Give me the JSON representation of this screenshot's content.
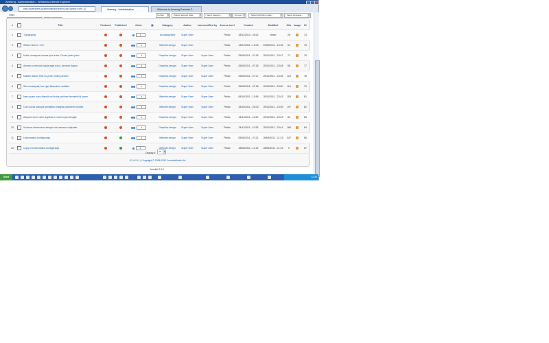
{
  "window": {
    "title": "Avarnng - Administration - Windows Internet Explorer",
    "url": "http://avarolliers.pl/administrator/index.php?option=com_k2",
    "tabs": [
      {
        "label": "Avarnng - Administration",
        "active": true
      },
      {
        "label": "Welcome to Avarnng Przeslan Z...",
        "active": false
      }
    ]
  },
  "filter": {
    "label": "Filter:",
    "go_label": "Go",
    "reset_label": "Reset",
    "selects": [
      "Current",
      "- Select featured state -",
      "- Select category -",
      "- No user -",
      "- Select publishing state -",
      "- Select language -"
    ]
  },
  "table": {
    "headers": [
      "#",
      "",
      "Title",
      "Featured",
      "Published",
      "Order",
      "",
      "Category",
      "Author",
      "Last modified by",
      "Access level",
      "Created",
      "Modified",
      "Hits",
      "Image",
      "ID"
    ],
    "rows": [
      {
        "num": "1",
        "title": "Typography",
        "featured": "red",
        "published": "red",
        "order": "1",
        "category": "Uncategorised",
        "author": "Super User",
        "modified_by": "",
        "access": "Public",
        "created": "18/11/2010 - 05:32",
        "modified": "Never",
        "hits": "28",
        "id": "74"
      },
      {
        "num": "2",
        "title": "What's New in 1.6?",
        "featured": "red",
        "published": "red",
        "order": "1",
        "category": "Website design",
        "author": "Super User",
        "modified_by": "",
        "access": "Public",
        "created": "13/01/2011 - 12:03",
        "modified": "20/05/2011 - 10:52",
        "hits": "64",
        "id": "75"
      },
      {
        "num": "3",
        "title": "Nulla consequat massa quis enim. Donec pede justo",
        "featured": "red",
        "published": "red",
        "order": "3",
        "category": "Graphics design",
        "author": "Super User",
        "modified_by": "Super User",
        "access": "Public",
        "created": "25/05/2011 - 07:15",
        "modified": "25/11/2011 - 23:47",
        "hits": "72",
        "id": "76"
      },
      {
        "num": "4",
        "title": "Aenean commodo ligula eget dolor. Aenean massa",
        "featured": "red",
        "published": "red",
        "order": "4",
        "category": "Graphics design",
        "author": "Super User",
        "modified_by": "Super User",
        "access": "Public",
        "created": "25/05/2011 - 07:16",
        "modified": "25/11/2011 - 23:48",
        "hits": "88",
        "id": "77"
      },
      {
        "num": "5",
        "title": "Nullam dictum felis eu pede mollis pretium",
        "featured": "red",
        "published": "red",
        "order": "2",
        "category": "Graphics design",
        "author": "Super User",
        "modified_by": "Super User",
        "access": "Public",
        "created": "25/05/2011 - 07:17",
        "modified": "25/11/2011 - 23:48",
        "hits": "120",
        "id": "78"
      },
      {
        "num": "6",
        "title": "Sed consequat, leo eget bibendum sodales",
        "featured": "red",
        "published": "red",
        "order": "1",
        "category": "Graphics design",
        "author": "Super User",
        "modified_by": "Super User",
        "access": "Public",
        "created": "25/05/2011 - 07:18",
        "modified": "25/11/2011 - 23:50",
        "hits": "116",
        "id": "79"
      },
      {
        "num": "7",
        "title": "Nam quam nunc blandit vel luctus pulvinar hendrerit id lorem",
        "featured": "red",
        "published": "red",
        "order": "2",
        "category": "Website design",
        "author": "Super User",
        "modified_by": "Super User",
        "access": "Public",
        "created": "08/10/2011 - 10:56",
        "modified": "25/11/2011 - 23:43",
        "hits": "153",
        "id": "81"
      },
      {
        "num": "8",
        "title": "Cum sociis natoque penatibus magnis parturient montes",
        "featured": "red",
        "published": "red",
        "order": "3",
        "category": "Website design",
        "author": "Super User",
        "modified_by": "Super User",
        "access": "Public",
        "created": "18/10/2011 - 02:03",
        "modified": "25/11/2011 - 23:39",
        "hits": "197",
        "id": "82"
      },
      {
        "num": "9",
        "title": "Aliquam lorem ante dapibus in viverra quis feugiat",
        "featured": "red",
        "published": "red",
        "order": "5",
        "category": "Graphics design",
        "author": "Super User",
        "modified_by": "Super User",
        "access": "Public",
        "created": "24/11/2011 - 10:30",
        "modified": "25/11/2011 - 23:42",
        "hits": "84",
        "id": "83"
      },
      {
        "num": "10",
        "title": "Vivamus elementum semper nisi aenean vulputate",
        "featured": "red",
        "published": "red",
        "order": "3",
        "category": "Graphics design",
        "author": "Super User",
        "modified_by": "Super User",
        "access": "Public",
        "created": "24/11/2011 - 10:33",
        "modified": "25/11/2011 - 23:41",
        "hits": "166",
        "id": "84"
      },
      {
        "num": "11",
        "title": "Uniwersalna konfiguracja",
        "featured": "red",
        "published": "green",
        "order": "1",
        "category": "Website design",
        "author": "Super User",
        "modified_by": "Super User",
        "access": "Public",
        "created": "05/06/2011 - 07:21",
        "modified": "26/06/2011 - 11:13",
        "hits": "347",
        "id": "86"
      },
      {
        "num": "12",
        "title": "Copy of Uniwersalna konfiguracja",
        "featured": "red",
        "published": "green",
        "order": "4",
        "category": "Website design",
        "author": "Super User",
        "modified_by": "Super User",
        "access": "Public",
        "created": "28/06/2011 - 11:13",
        "modified": "28/06/2011 - 11:15",
        "hits": "0",
        "id": "87"
      }
    ]
  },
  "pager": {
    "label": "Display #",
    "value": "20"
  },
  "footer": {
    "k2": "K2 v2.5.1 | Copyright © 2006-2011 JoomlaWorks Ltd.",
    "joomla_version": "Joomla! 2.5.0",
    "license_prefix": "Joomla!® is free software released under the",
    "license_link": "GNU General Public License."
  },
  "taskbar": {
    "start_label": "Start",
    "clock": "12:39"
  },
  "colors": {
    "titlebar": "#1b4f9c",
    "link": "#135cae",
    "unpublished": "#d5532a",
    "published": "#3a9b3a",
    "taskbar": "#2f5fae"
  }
}
